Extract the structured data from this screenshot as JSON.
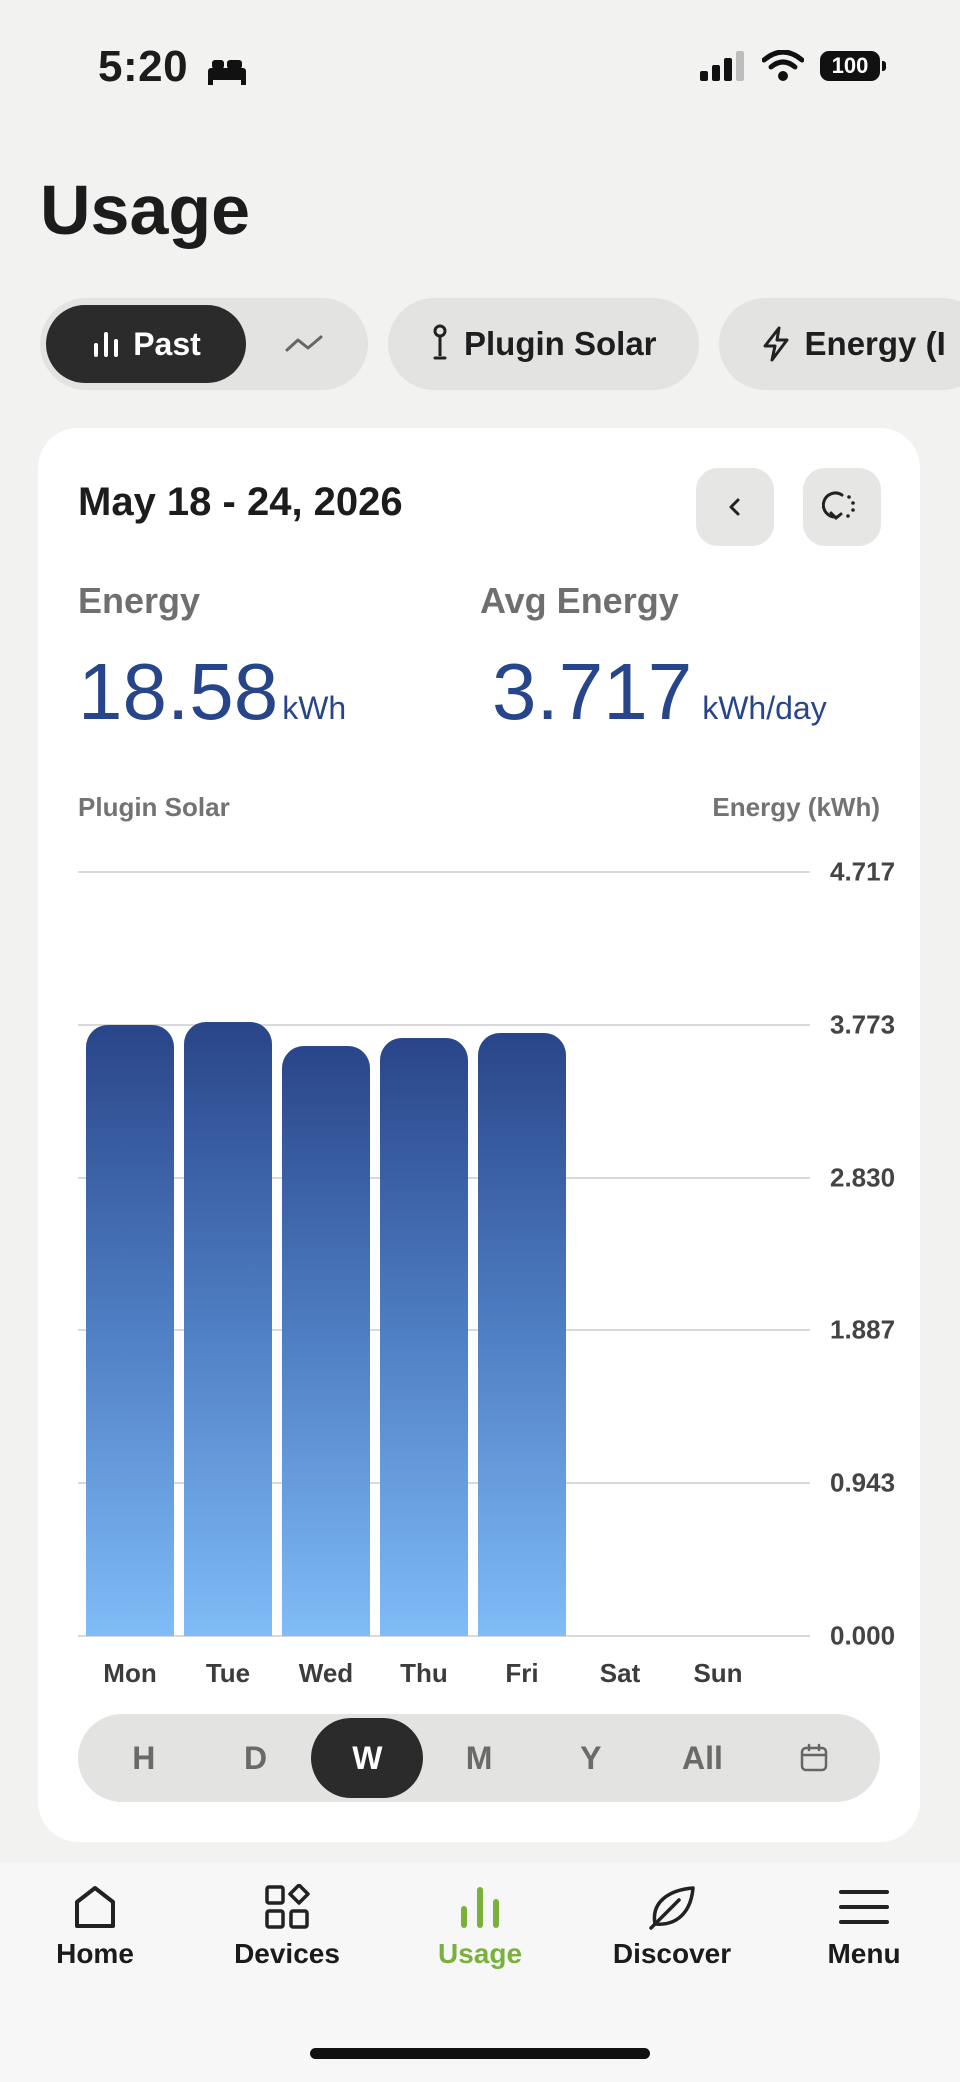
{
  "status": {
    "time": "5:20",
    "battery": "100"
  },
  "header": {
    "title": "Usage"
  },
  "chips": {
    "past": "Past",
    "plugin_solar": "Plugin Solar",
    "energy": "Energy (I"
  },
  "card": {
    "date_range": "May 18 - 24, 2026",
    "energy": {
      "label": "Energy",
      "value": "18.58",
      "unit": "kWh"
    },
    "avg_energy": {
      "label": "Avg Energy",
      "value": "3.717",
      "unit": "kWh/day"
    },
    "series_label": "Plugin Solar",
    "axis_label": "Energy (kWh)"
  },
  "chart_data": {
    "type": "bar",
    "title": "",
    "series_name": "Plugin Solar",
    "ylabel": "Energy (kWh)",
    "categories": [
      "Mon",
      "Tue",
      "Wed",
      "Thu",
      "Fri",
      "Sat",
      "Sun"
    ],
    "values": [
      3.77,
      3.79,
      3.64,
      3.69,
      3.72,
      0,
      0
    ],
    "y_ticks": [
      "4.717",
      "3.773",
      "2.830",
      "1.887",
      "0.943",
      "0.000"
    ],
    "ylim": [
      0,
      4.717
    ],
    "bar_gradient": [
      "#2a4589",
      "#80bcf7"
    ]
  },
  "range_selector": {
    "options": [
      "H",
      "D",
      "W",
      "M",
      "Y",
      "All"
    ],
    "selected": "W"
  },
  "nav": {
    "home": "Home",
    "devices": "Devices",
    "usage": "Usage",
    "discover": "Discover",
    "menu": "Menu"
  },
  "colors": {
    "accent": "#7ab03c",
    "value_blue": "#27458a"
  }
}
